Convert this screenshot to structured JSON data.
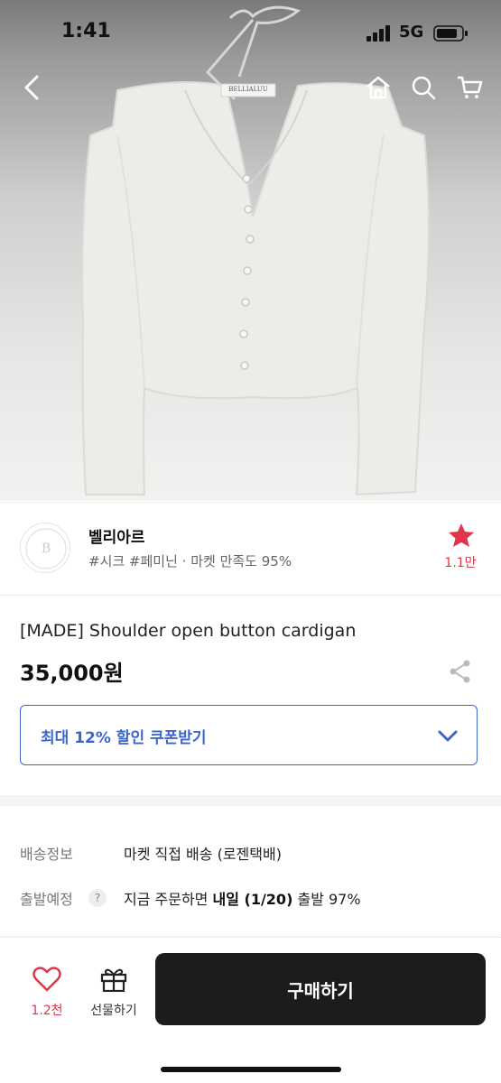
{
  "status_bar": {
    "time": "1:41",
    "network": "5G"
  },
  "hero": {
    "label_tag": "BELLIALUU"
  },
  "seller": {
    "name": "벨리아르",
    "tags": "#시크 #페미닌 · 마켓 만족도 95%",
    "favorite_count": "1.1만",
    "star_color": "#e0354a"
  },
  "product": {
    "title": "[MADE] Shoulder open button cardigan",
    "price": "35,000원"
  },
  "coupon": {
    "label": "최대 12% 할인 쿠폰받기",
    "accent": "#3c67c9"
  },
  "shipping": {
    "label": "배송정보",
    "value": "마켓 직접 배송 (로젠택배)"
  },
  "departure": {
    "label": "출발예정",
    "help": "?",
    "value_prefix": "지금 주문하면 ",
    "value_bold": "내일 (1/20)",
    "value_suffix": " 출발 97%"
  },
  "bottom_bar": {
    "like_count": "1.2천",
    "gift_label": "선물하기",
    "buy_label": "구매하기"
  },
  "icons": [
    "back-icon",
    "home-icon",
    "search-icon",
    "cart-icon",
    "star-icon",
    "share-icon",
    "chevron-down-icon",
    "help-icon",
    "heart-icon",
    "gift-icon"
  ]
}
